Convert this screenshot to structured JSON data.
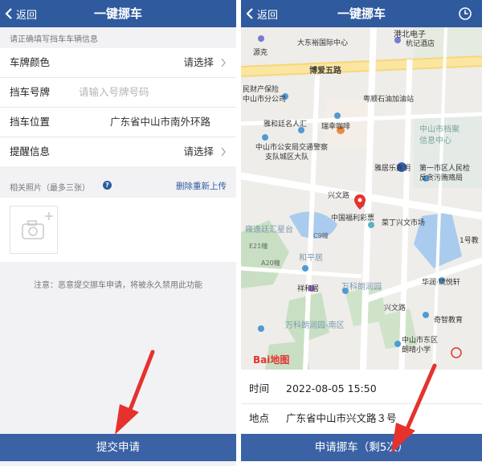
{
  "left": {
    "header": {
      "back_label": "返回",
      "title": "一键挪车"
    },
    "hint": "请正确填写挡车车辆信息",
    "form": {
      "plate_color": {
        "label": "车牌颜色",
        "value": "请选择"
      },
      "plate_number": {
        "label": "挡车号牌",
        "placeholder": "请输入号牌号码"
      },
      "location": {
        "label": "挡车位置",
        "value": "广东省中山市南外环路"
      },
      "reminder": {
        "label": "提醒信息",
        "value": "请选择"
      }
    },
    "photos": {
      "label": "相关照片（最多三张）",
      "help_icon": "question-icon",
      "reupload": "删除重新上传"
    },
    "notice": "注意：恶意提交挪车申请，将被永久禁用此功能",
    "submit": "提交申请"
  },
  "right": {
    "header": {
      "back_label": "返回",
      "title": "一键挪车",
      "history_icon": "clock-icon"
    },
    "map": {
      "labels": {
        "gangbei": "港北电子",
        "dayongfu": "大东裕国际中心",
        "hanglu": "杭记酒店",
        "yuanke": "源克",
        "boai5": "博爱五路",
        "minbao": "民财产保险",
        "zhongshan_fen": "中山市分公司",
        "yuejiu": "粤顺石油加油站",
        "zhongshan_dangan": "中山市档案",
        "xinxi": "信息中心",
        "yahe": "雅和廷名人汇",
        "ruixing": "瑞幸咖啡",
        "gongan1": "中山市公安局交通警察",
        "gongan2": "支队城区大队",
        "yajing": "雅居乐嘉玥",
        "diyi1": "第一市区人民检",
        "diyi2": "反贪污贿赂局",
        "xingwen": "兴文路",
        "fucai": "中国福利彩票",
        "caishen": "菜丁兴文市场",
        "yiji": "1号教",
        "pingyi": "雍逸廷汇星台",
        "c9": "C9幢",
        "e21": "E21幢",
        "a20": "A20幢",
        "hemao": "和平居",
        "xianghe": "祥和居",
        "wanke": "万科朗润园",
        "huarun": "华润·琉悦轩",
        "xingwen2": "兴文路",
        "qizhi": "奇智教育",
        "wanke_south": "万科朗润园-南区",
        "dongqu": "中山市东区",
        "langqing": "朗晴小学",
        "baidu": "Bai地图"
      }
    },
    "info": {
      "time": {
        "label": "时间",
        "value": "2022-08-05 15:50"
      },
      "place": {
        "label": "地点",
        "value": "广东省中山市兴文路３号"
      }
    },
    "submit": "申请挪车（剩5次）"
  },
  "colors": {
    "header": "#2f5a9e",
    "button": "#3a62a5",
    "link": "#2f5a9e",
    "arrow": "#e5322d"
  }
}
